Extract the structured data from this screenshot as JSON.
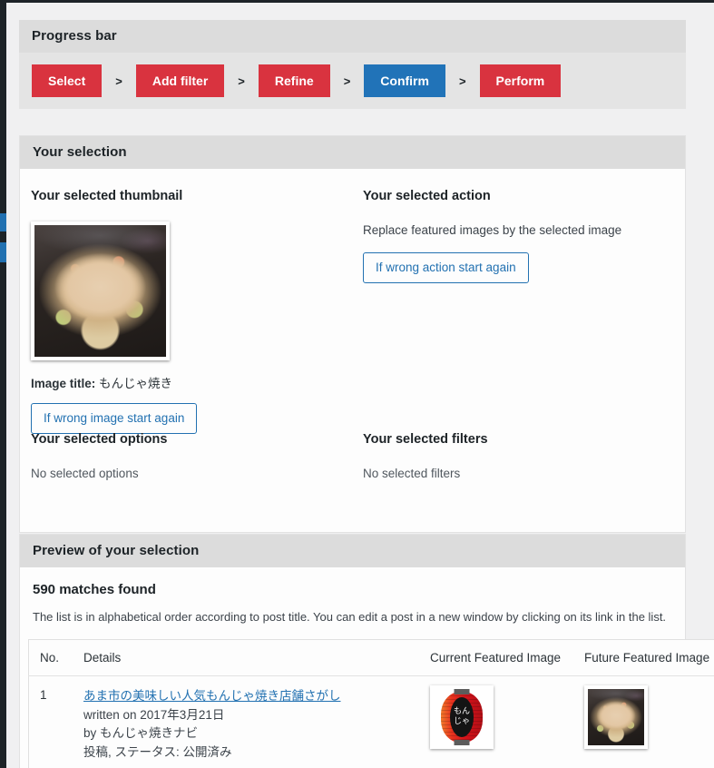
{
  "progress": {
    "panel_title": "Progress bar",
    "steps": [
      {
        "label": "Select",
        "state": "done"
      },
      {
        "label": "Add filter",
        "state": "done"
      },
      {
        "label": "Refine",
        "state": "done"
      },
      {
        "label": "Confirm",
        "state": "active"
      },
      {
        "label": "Perform",
        "state": "todo"
      }
    ],
    "separator": ">",
    "colors": {
      "done": "#d9333f",
      "active": "#2173b8",
      "todo": "#d9333f"
    }
  },
  "selection": {
    "panel_title": "Your selection",
    "thumbnail": {
      "heading": "Your selected thumbnail",
      "caption_label": "Image title:",
      "caption_value": "もんじゃ焼き",
      "reset_button": "If wrong image start again",
      "image_alt": "monjayaki-thumbnail"
    },
    "action": {
      "heading": "Your selected action",
      "description": "Replace featured images by the selected image",
      "reset_button": "If wrong action start again"
    },
    "options": {
      "heading": "Your selected options",
      "value": "No selected options"
    },
    "filters": {
      "heading": "Your selected filters",
      "value": "No selected filters"
    }
  },
  "preview": {
    "panel_title": "Preview of your selection",
    "matches": "590 matches found",
    "note": "The list is in alphabetical order according to post title. You can edit a post in a new window by clicking on its link in the list.",
    "columns": [
      "No.",
      "Details",
      "Current Featured Image",
      "Future Featured Image"
    ],
    "rows": [
      {
        "no": "1",
        "title": "あま市の美味しい人気もんじゃ焼き店舗さがし",
        "written_on": "written on 2017年3月21日",
        "author": "by もんじゃ焼きナビ",
        "status": "投稿, ステータス: 公開済み",
        "current_image_alt": "red-lantern-monja",
        "current_image_chars": "もんじゃ",
        "future_image_alt": "monjayaki-thumbnail"
      }
    ]
  },
  "theme": {
    "accent_blue": "#2271b1",
    "admin_dark": "#1d2327",
    "panel_header_gray": "#dcdcdc",
    "page_bg": "#f0f0f1"
  }
}
